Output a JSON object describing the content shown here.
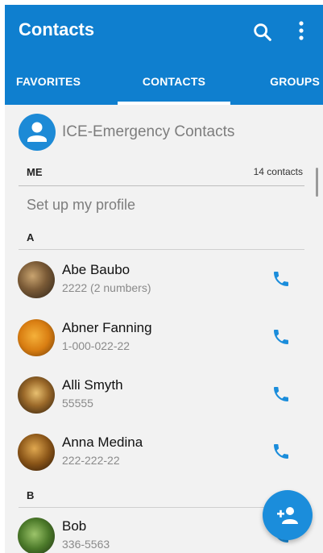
{
  "app": {
    "title": "Contacts"
  },
  "tabs": [
    {
      "label": "FAVORITES"
    },
    {
      "label": "CONTACTS",
      "selected": true
    },
    {
      "label": "GROUPS"
    }
  ],
  "ice": {
    "label": "ICE-Emergency Contacts"
  },
  "me": {
    "header": "ME",
    "count": "14 contacts",
    "setup": "Set up my profile"
  },
  "sections": [
    {
      "letter": "A",
      "contacts": [
        {
          "name": "Abe Baubo",
          "number": "2222 (2 numbers)"
        },
        {
          "name": "Abner Fanning",
          "number": "1-000-022-22"
        },
        {
          "name": "Alli Smyth",
          "number": "55555"
        },
        {
          "name": "Anna Medina",
          "number": "222-222-22"
        }
      ]
    },
    {
      "letter": "B",
      "contacts": [
        {
          "name": "Bob",
          "number": "336-5563"
        }
      ]
    }
  ],
  "colors": {
    "primary": "#0f7fcf",
    "accent": "#1b8ddb",
    "background": "#f2f2f2"
  },
  "icons": {
    "search": "search-icon",
    "more": "more-vert-icon",
    "call": "phone-icon",
    "fab": "add-person-icon"
  }
}
